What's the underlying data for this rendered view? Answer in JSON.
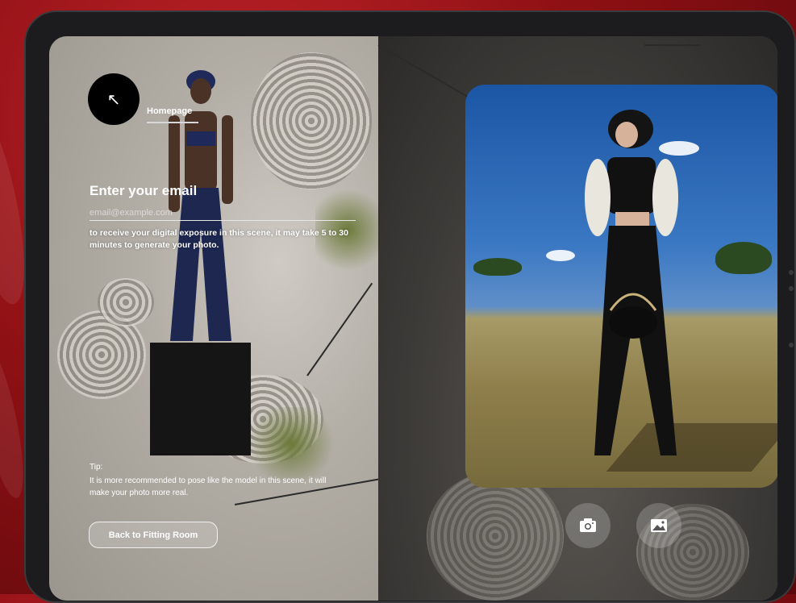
{
  "nav": {
    "back_arrow": "↖",
    "homepage_label": "Homepage"
  },
  "form": {
    "title": "Enter your email",
    "email_placeholder": "email@example.com",
    "description": "to receive your digital exposure in this scene, it may take 5 to 30 minutes to generate your photo."
  },
  "tip": {
    "label": "Tip:",
    "text": "It is more recommended to pose like the model in this scene, it will make your photo more real."
  },
  "buttons": {
    "back_to_fitting_room": "Back to Fitting Room"
  },
  "icons": {
    "camera": "camera-icon",
    "gallery": "image-gallery-icon"
  },
  "colors": {
    "background_red": "#8e1014",
    "button_black": "#000000"
  }
}
